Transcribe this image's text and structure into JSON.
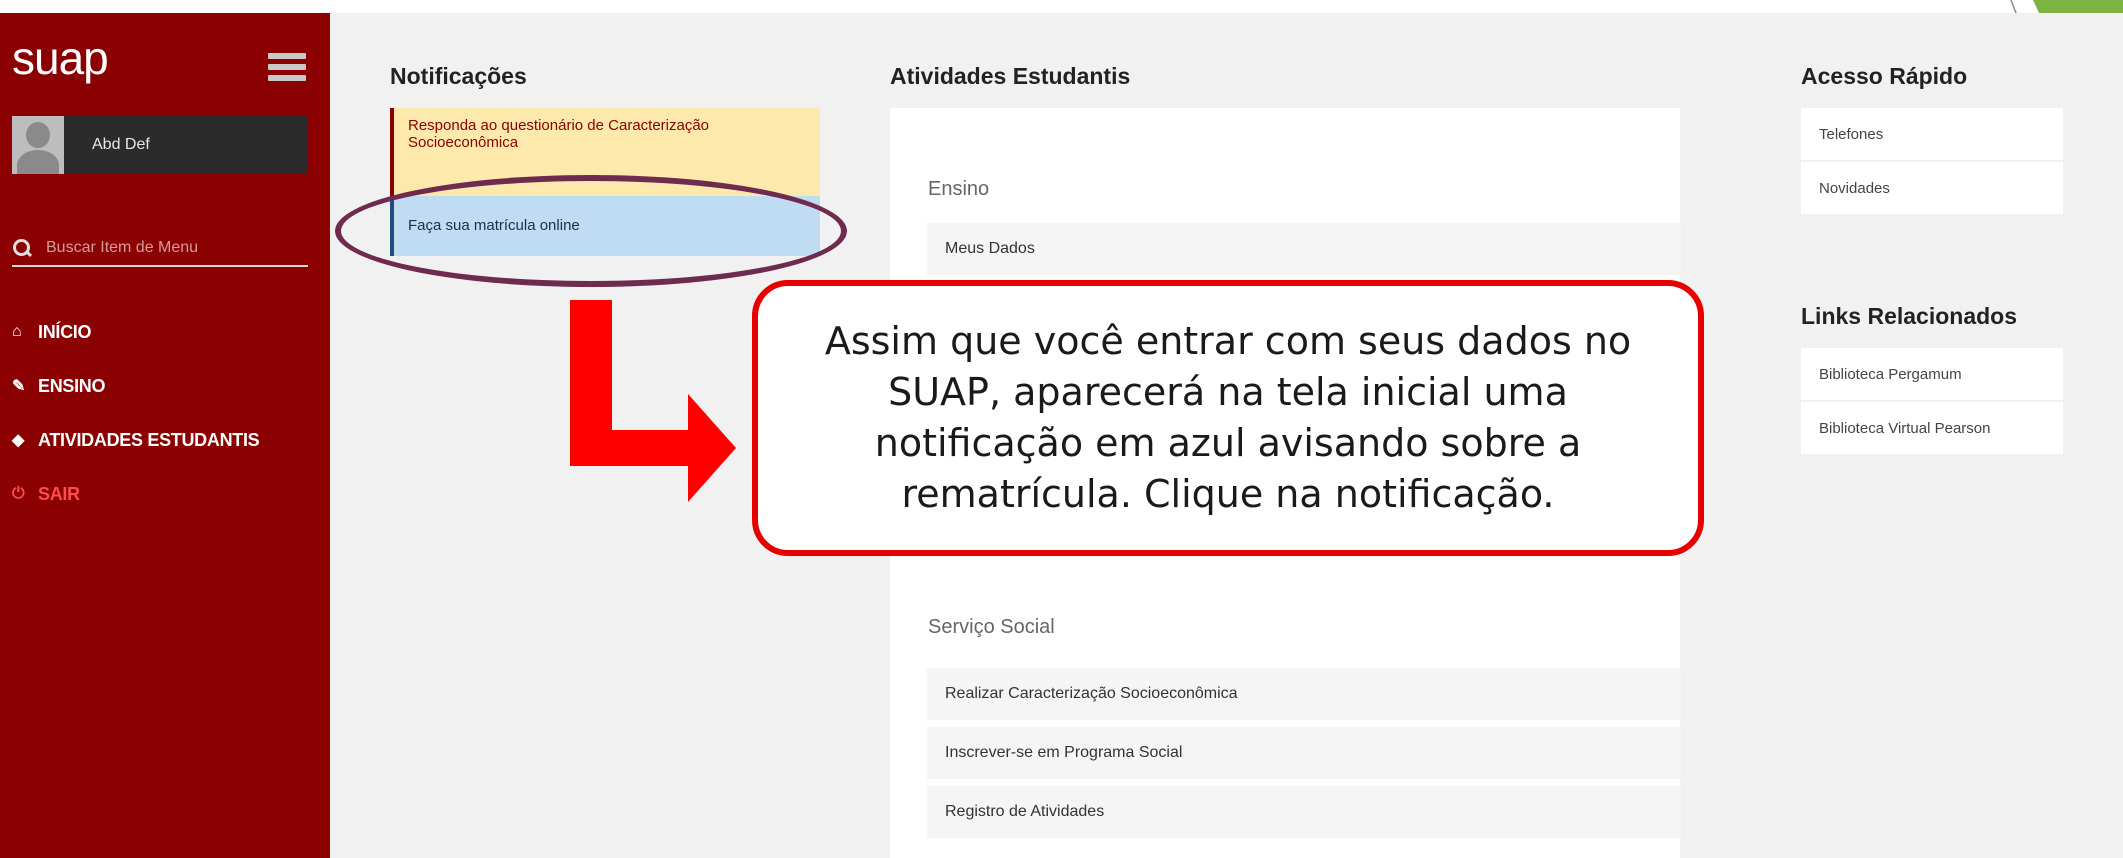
{
  "sidebar": {
    "logo": "suap",
    "user_name": "Abd Def",
    "search_placeholder": "Buscar Item de Menu",
    "menu": [
      {
        "label": "INÍCIO",
        "icon": "home-icon"
      },
      {
        "label": "ENSINO",
        "icon": "pencil-circle-icon"
      },
      {
        "label": "ATIVIDADES ESTUDANTIS",
        "icon": "graduation-cap-icon"
      },
      {
        "label": "SAIR",
        "icon": "power-icon"
      }
    ],
    "colors": {
      "background": "#8b0000",
      "sair": "#ff4d4d"
    }
  },
  "notifications": {
    "title": "Notificações",
    "items": [
      {
        "text": "Responda ao questionário de Caracterização Socioeconômica",
        "style": "yellow"
      },
      {
        "text": "Faça sua matrícula online",
        "style": "blue"
      }
    ]
  },
  "activities": {
    "title": "Atividades Estudantis",
    "groups": [
      {
        "title": "Ensino",
        "items": [
          "Meus Dados"
        ]
      },
      {
        "title": "Serviço Social",
        "items": [
          "Realizar Caracterização Socioeconômica",
          "Inscrever-se em Programa Social",
          "Registro de Atividades"
        ]
      }
    ]
  },
  "quick_access": {
    "title": "Acesso Rápido",
    "items": [
      "Telefones",
      "Novidades"
    ]
  },
  "related_links": {
    "title": "Links Relacionados",
    "items": [
      "Biblioteca Pergamum",
      "Biblioteca Virtual Pearson"
    ]
  },
  "annotation": {
    "callout_text": "Assim que você entrar com seus dados no SUAP, aparecerá na tela inicial uma notificação em azul avisando sobre a rematrícula. Clique na notificação.",
    "colors": {
      "arrow": "#ff0000",
      "ellipse": "#6e2a4f",
      "border": "#e60000"
    }
  }
}
